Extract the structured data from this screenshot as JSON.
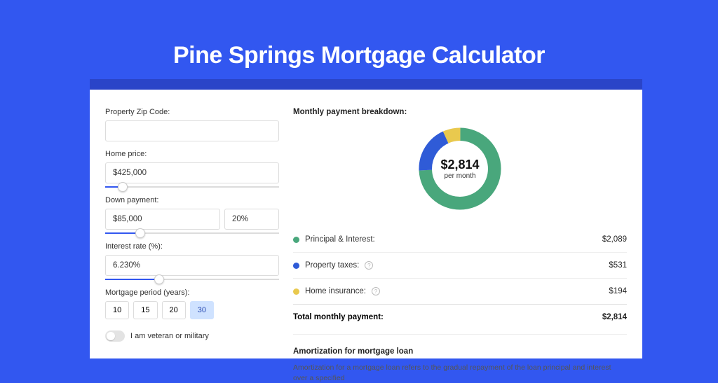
{
  "title": "Pine Springs Mortgage Calculator",
  "form": {
    "zip_label": "Property Zip Code:",
    "zip_value": "",
    "home_price_label": "Home price:",
    "home_price_value": "$425,000",
    "down_payment_label": "Down payment:",
    "down_payment_value": "$85,000",
    "down_payment_pct": "20%",
    "interest_label": "Interest rate (%):",
    "interest_value": "6.230%",
    "period_label": "Mortgage period (years):",
    "periods": [
      "10",
      "15",
      "20",
      "30"
    ],
    "period_selected": "30",
    "veteran_label": "I am veteran or military"
  },
  "breakdown": {
    "title": "Monthly payment breakdown:",
    "center_value": "$2,814",
    "center_sub": "per month",
    "items": [
      {
        "label": "Principal & Interest:",
        "value": "$2,089",
        "color": "#49a77c",
        "info": false
      },
      {
        "label": "Property taxes:",
        "value": "$531",
        "color": "#2f5bd7",
        "info": true
      },
      {
        "label": "Home insurance:",
        "value": "$194",
        "color": "#e9c94e",
        "info": true
      }
    ],
    "total_label": "Total monthly payment:",
    "total_value": "$2,814"
  },
  "amort": {
    "title": "Amortization for mortgage loan",
    "body": "Amortization for a mortgage loan refers to the gradual repayment of the loan principal and interest over a specified"
  },
  "chart_data": {
    "type": "pie",
    "title": "Monthly payment breakdown",
    "series": [
      {
        "name": "Principal & Interest",
        "value": 2089,
        "color": "#49a77c"
      },
      {
        "name": "Property taxes",
        "value": 531,
        "color": "#2f5bd7"
      },
      {
        "name": "Home insurance",
        "value": 194,
        "color": "#e9c94e"
      }
    ],
    "total": 2814,
    "center_label": "$2,814 per month"
  }
}
